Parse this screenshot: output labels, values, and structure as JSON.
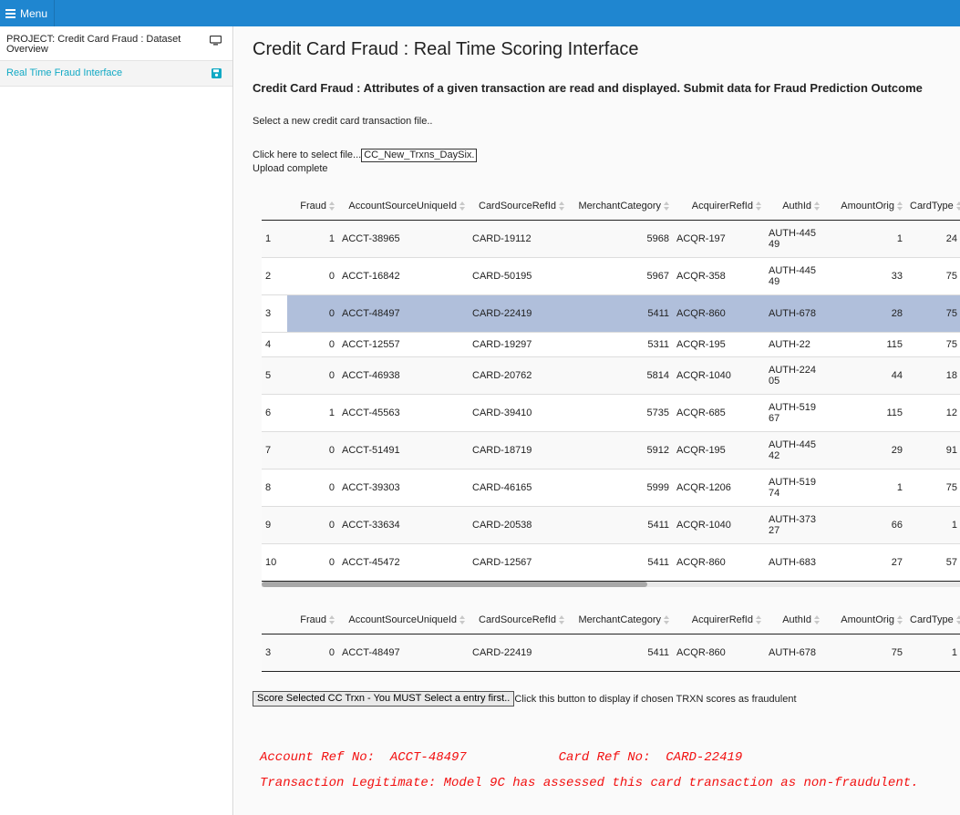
{
  "topbar": {
    "menu_label": "Menu",
    "background": "#1f86d0"
  },
  "sidebar": {
    "items": [
      {
        "label": "PROJECT: Credit Card Fraud : Dataset Overview",
        "icon": "monitor-icon",
        "active": false
      },
      {
        "label": "Real Time Fraud Interface",
        "icon": "save-icon",
        "active": true
      }
    ],
    "active_color": "#11a9c4"
  },
  "main": {
    "title": "Credit Card Fraud : Real Time Scoring Interface",
    "subtitle": "Credit Card Fraud : Attributes of a given transaction are read and displayed. Submit data for Fraud Prediction Outcome",
    "select_hint": "Select a new credit card transaction file..",
    "file_label": "Click here to select file...",
    "file_name": "CC_New_Trxns_DaySix.",
    "upload_status": "Upload complete"
  },
  "table": {
    "columns": [
      "Fraud",
      "AccountSourceUniqueId",
      "CardSourceRefId",
      "MerchantCategory",
      "AcquirerRefId",
      "AuthId",
      "AmountOrig",
      "CardType"
    ],
    "rows": [
      {
        "idx": "1",
        "fraud": "1",
        "account": "ACCT-38965",
        "card": "CARD-19112",
        "merchant": "5968",
        "acquirer": "ACQR-197",
        "auth": "AUTH-44549",
        "amount": "1",
        "cardtype": "24"
      },
      {
        "idx": "2",
        "fraud": "0",
        "account": "ACCT-16842",
        "card": "CARD-50195",
        "merchant": "5967",
        "acquirer": "ACQR-358",
        "auth": "AUTH-44549",
        "amount": "33",
        "cardtype": "75"
      },
      {
        "idx": "3",
        "fraud": "0",
        "account": "ACCT-48497",
        "card": "CARD-22419",
        "merchant": "5411",
        "acquirer": "ACQR-860",
        "auth": "AUTH-678",
        "amount": "28",
        "cardtype": "75"
      },
      {
        "idx": "4",
        "fraud": "0",
        "account": "ACCT-12557",
        "card": "CARD-19297",
        "merchant": "5311",
        "acquirer": "ACQR-195",
        "auth": "AUTH-22",
        "amount": "115",
        "cardtype": "75"
      },
      {
        "idx": "5",
        "fraud": "0",
        "account": "ACCT-46938",
        "card": "CARD-20762",
        "merchant": "5814",
        "acquirer": "ACQR-1040",
        "auth": "AUTH-22405",
        "amount": "44",
        "cardtype": "18"
      },
      {
        "idx": "6",
        "fraud": "1",
        "account": "ACCT-45563",
        "card": "CARD-39410",
        "merchant": "5735",
        "acquirer": "ACQR-685",
        "auth": "AUTH-51967",
        "amount": "115",
        "cardtype": "12"
      },
      {
        "idx": "7",
        "fraud": "0",
        "account": "ACCT-51491",
        "card": "CARD-18719",
        "merchant": "5912",
        "acquirer": "ACQR-195",
        "auth": "AUTH-44542",
        "amount": "29",
        "cardtype": "91"
      },
      {
        "idx": "8",
        "fraud": "0",
        "account": "ACCT-39303",
        "card": "CARD-46165",
        "merchant": "5999",
        "acquirer": "ACQR-1206",
        "auth": "AUTH-51974",
        "amount": "1",
        "cardtype": "75"
      },
      {
        "idx": "9",
        "fraud": "0",
        "account": "ACCT-33634",
        "card": "CARD-20538",
        "merchant": "5411",
        "acquirer": "ACQR-1040",
        "auth": "AUTH-37327",
        "amount": "66",
        "cardtype": "1"
      },
      {
        "idx": "10",
        "fraud": "0",
        "account": "ACCT-45472",
        "card": "CARD-12567",
        "merchant": "5411",
        "acquirer": "ACQR-860",
        "auth": "AUTH-683",
        "amount": "27",
        "cardtype": "57"
      }
    ],
    "selected_row": 3,
    "selected_color": "#b0bfdb"
  },
  "selected_table": {
    "columns": [
      "Fraud",
      "AccountSourceUniqueId",
      "CardSourceRefId",
      "MerchantCategory",
      "AcquirerRefId",
      "AuthId",
      "AmountOrig",
      "CardType"
    ],
    "row": {
      "idx": "3",
      "fraud": "0",
      "account": "ACCT-48497",
      "card": "CARD-22419",
      "merchant": "5411",
      "acquirer": "ACQR-860",
      "auth": "AUTH-678",
      "amount": "75",
      "cardtype": "1"
    }
  },
  "score": {
    "button_label": "Score Selected CC Trxn - You MUST Select a entry first..",
    "button_hint": "Click this button to display if chosen TRXN scores as fraudulent"
  },
  "result": {
    "line1": "Account Ref No:  ACCT-48497            Card Ref No:  CARD-22419",
    "line2": "Transaction Legitimate: Model 9C has assessed this card transaction as non-fraudulent.",
    "color": "#f21010"
  }
}
